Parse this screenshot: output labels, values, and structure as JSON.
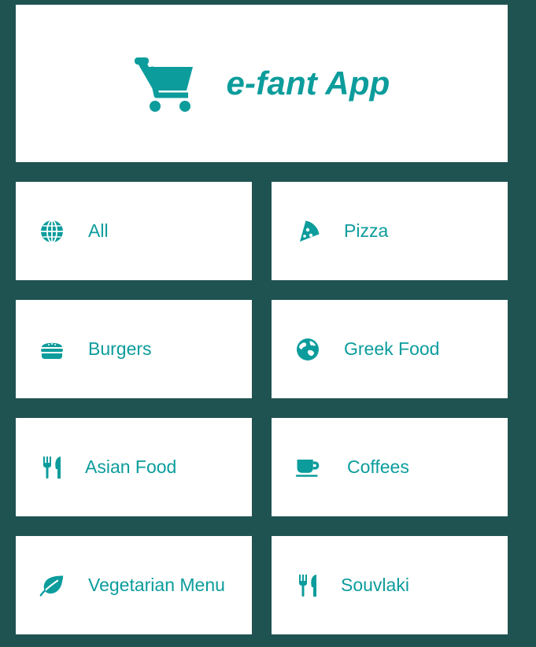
{
  "header": {
    "title": "e-fant App",
    "icon": "shopping-cart-icon"
  },
  "colors": {
    "background": "#1f5351",
    "card": "#ffffff",
    "accent": "#0c9c9c"
  },
  "categories": [
    {
      "label": "All",
      "icon": "globe-icon"
    },
    {
      "label": "Pizza",
      "icon": "pizza-slice-icon"
    },
    {
      "label": "Burgers",
      "icon": "hamburger-icon"
    },
    {
      "label": "Greek Food",
      "icon": "earth-europe-icon"
    },
    {
      "label": "Asian Food",
      "icon": "utensils-icon"
    },
    {
      "label": "Coffees",
      "icon": "coffee-mug-icon"
    },
    {
      "label": "Vegetarian Menu",
      "icon": "leaf-icon"
    },
    {
      "label": "Souvlaki",
      "icon": "utensils-icon"
    }
  ]
}
